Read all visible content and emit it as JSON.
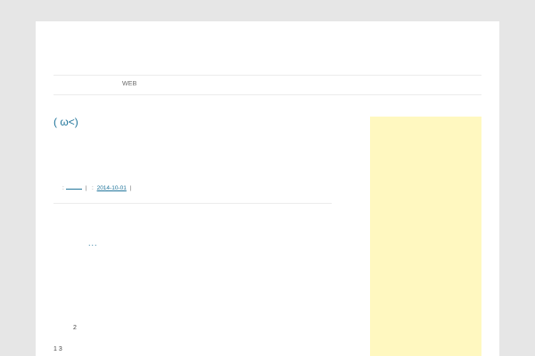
{
  "nav": {
    "items": [
      {
        "label": "WEB"
      }
    ]
  },
  "post": {
    "title": "( ω<)",
    "meta": {
      "prefix_colon": ":",
      "separator": "|",
      "date_prefix": ":",
      "date": "2014-10-01",
      "trailing_separator": "|"
    },
    "more_label": "...",
    "body_line_1": "2",
    "body_line_2": "1 3"
  },
  "colors": {
    "background": "#e6e6e6",
    "page": "#ffffff",
    "link": "#21759b",
    "sidebar_ad": "#fff8c0"
  }
}
